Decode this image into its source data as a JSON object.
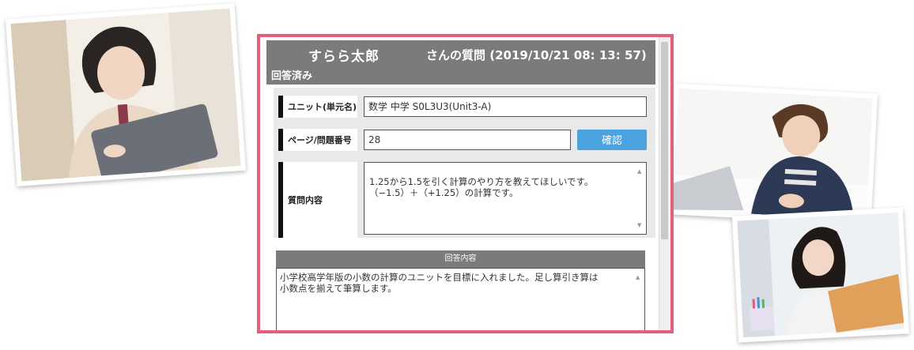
{
  "question_form": {
    "header": {
      "student_name": "すらら太郎",
      "subject_line": "さんの質問 (2019/10/21 08: 13: 57)",
      "status": "回答済み"
    },
    "unit": {
      "label": "ユニット(単元名)",
      "value": "数学 中学 S0L3U3(Unit3-A)"
    },
    "page": {
      "label": "ページ/問題番号",
      "value": "28",
      "confirm_button": "確認"
    },
    "question": {
      "label": "質問内容",
      "text": "1.25から1.5を引く計算のやり方を教えてほしいです。\n（−1.5）＋（+1.25）の計算です。"
    },
    "answer": {
      "header": "回答内容",
      "text": "小学校高学年版の小数の計算のユニットを目標に入れました。足し算引き算は\n小数点を揃えて筆算します。"
    }
  },
  "colors": {
    "panel_border": "#e4607a",
    "header_bg": "#7b7b7b",
    "button": "#4aa3df"
  },
  "photos": [
    {
      "name": "student-with-tablet-photo"
    },
    {
      "name": "boy-writing-at-laptop-photo"
    },
    {
      "name": "girl-with-laptop-photo"
    }
  ]
}
